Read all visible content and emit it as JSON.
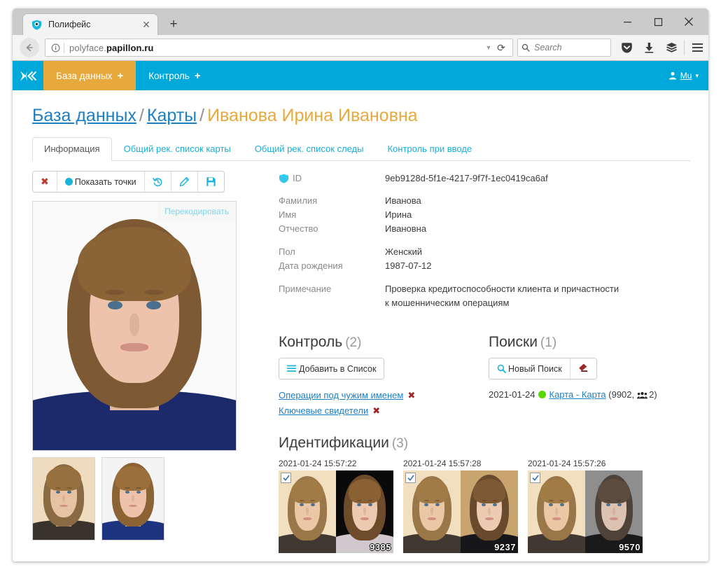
{
  "browser": {
    "tab_title": "Полифейс",
    "favicon": "shield-icon",
    "new_tab_label": "+",
    "close_tab_label": "✕",
    "url_prefix": "polyface.",
    "url_domain": "papillon.ru",
    "search_placeholder": "Search",
    "window_minimize": "—",
    "window_maximize": "□",
    "window_close": "✕"
  },
  "appnav": {
    "logo": "polyface-logo-icon",
    "items": [
      {
        "label": "База данных",
        "plus": "+",
        "active": true
      },
      {
        "label": "Контроль",
        "plus": "+",
        "active": false
      }
    ],
    "user": {
      "name": "Mu",
      "caret": "▾"
    }
  },
  "breadcrumb": {
    "root": "База данных",
    "section": "Карты",
    "current": "Иванова Ирина Ивановна",
    "sep": "/"
  },
  "tabs": [
    {
      "label": "Информация",
      "active": true
    },
    {
      "label": "Общий рек. список карты",
      "active": false
    },
    {
      "label": "Общий рек. список следы",
      "active": false
    },
    {
      "label": "Контроль при вводе",
      "active": false
    }
  ],
  "toolbar": {
    "delete_label": "✖",
    "show_points_label": "Показать точки",
    "history_label": "history-icon",
    "edit_label": "pencil-icon",
    "save_label": "save-icon"
  },
  "photo": {
    "recode_label": "Перекодировать"
  },
  "info": {
    "id_label": "ID",
    "id_value": "9eb9128d-5f1e-4217-9f7f-1ec0419ca6af",
    "rows": [
      {
        "label": "Фамилия",
        "value": "Иванова",
        "gap": false
      },
      {
        "label": "Имя",
        "value": "Ирина",
        "gap": false
      },
      {
        "label": "Отчество",
        "value": "Ивановна",
        "gap": false
      },
      {
        "label": "Пол",
        "value": "Женский",
        "gap": true
      },
      {
        "label": "Дата рождения",
        "value": "1987-07-12",
        "gap": false
      }
    ],
    "note_label": "Примечание",
    "note_line1": "Проверка кредитоспособности клиента и причастности",
    "note_line2": "к мошенническим операциям"
  },
  "control": {
    "title": "Контроль",
    "count": "(2)",
    "add_button": "Добавить в Список",
    "items": [
      {
        "label": "Операции под чужим именем",
        "remove": "✖"
      },
      {
        "label": "Ключевые свидетели",
        "remove": "✖"
      }
    ]
  },
  "searches": {
    "title": "Поиски",
    "count": "(1)",
    "new_search_button": "Новый Поиск",
    "clear_button": "eraser-icon",
    "results": [
      {
        "date": "2021-01-24",
        "status": "green",
        "link": "Карта - Карта",
        "open_paren": "(",
        "code": "9902",
        "comma": ",",
        "people_count": "2",
        "close_paren": ")"
      }
    ]
  },
  "identifications": {
    "title": "Идентификации",
    "count": "(3)",
    "cards": [
      {
        "timestamp": "2021-01-24 15:57:22",
        "score": "9385",
        "checked": true
      },
      {
        "timestamp": "2021-01-24 15:57:28",
        "score": "9237",
        "checked": true
      },
      {
        "timestamp": "2021-01-24 15:57:26",
        "score": "9570",
        "checked": true
      }
    ]
  },
  "colors": {
    "accent_cyan": "#00a9d9",
    "accent_orange": "#e8a93c",
    "link_blue": "#1e7fc2",
    "tab_cyan": "#15b0d8",
    "status_green": "#56d800",
    "danger_red": "#a02525"
  }
}
